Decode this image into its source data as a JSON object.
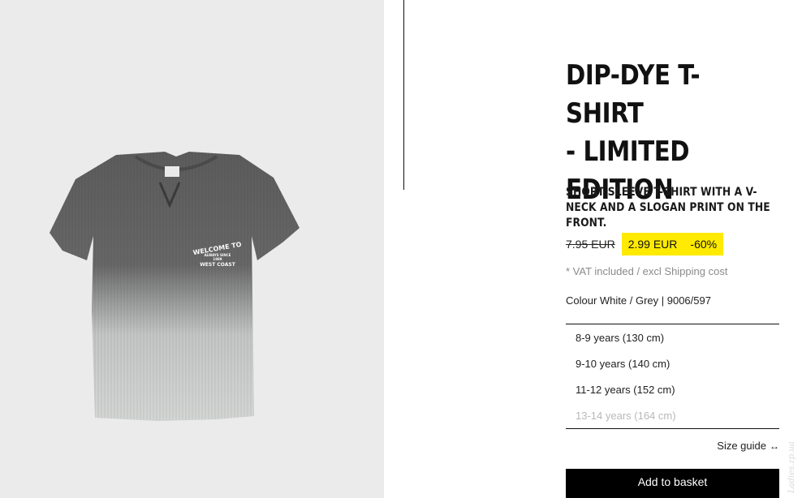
{
  "product": {
    "title": "DIP-DYE T-SHIRT\n- LIMITED\nEDITION",
    "description": "SHORT SLEEVE T-SHIRT WITH A V-NECK AND A SLOGAN PRINT ON THE FRONT.",
    "old_price": "7.95 EUR",
    "new_price": "2.99 EUR",
    "discount": "-60%",
    "vat_note": "* VAT included / excl Shipping cost",
    "colour": "Colour White / Grey | 9006/597",
    "print_lines": [
      "WELCOME TO",
      "ALWAYS SINCE",
      "1989",
      "WEST COAST"
    ]
  },
  "sizes": [
    {
      "label": "8-9 years (130 cm)",
      "available": true
    },
    {
      "label": "9-10 years (140 cm)",
      "available": true
    },
    {
      "label": "11-12 years (152 cm)",
      "available": true
    },
    {
      "label": "13-14 years (164 cm)",
      "available": false
    }
  ],
  "size_guide_label": "Size guide",
  "add_to_basket_label": "Add to basket",
  "watermark": "Ladies.zp.ua",
  "colors": {
    "sale_highlight": "#ffea00",
    "button_bg": "#000000",
    "image_bg": "#ebebeb"
  },
  "icons": {
    "size_guide": "ruler-icon"
  }
}
